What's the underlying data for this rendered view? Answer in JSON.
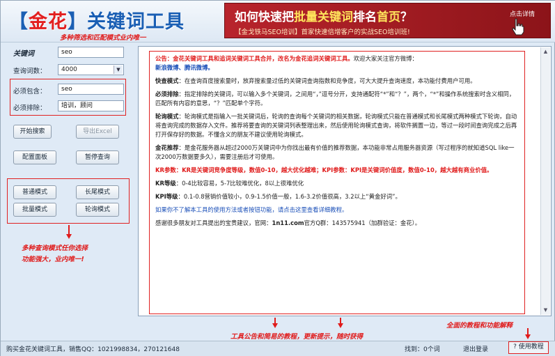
{
  "header": {
    "logo": {
      "bracket_open": "【",
      "jinhua": "金花",
      "bracket_close": "】",
      "title": "关键词工具"
    },
    "banner": {
      "title_pre": "如何快速把",
      "title_hl": "批量关键词",
      "title_mid": "排名",
      "title_hl2": "首页",
      "title_end": "？",
      "subtitle": "【金戈铁马SEO培训】首家快速倍增客户的实战SEO培训班!",
      "detail": "点击详情"
    }
  },
  "annotations": {
    "filter_modes": "多种筛选和匹配模式业内唯一",
    "keyword_label": "关键词",
    "query_modes": "多种查询模式任你选择\n功能强大，业内唯一!",
    "notice_tutorial": "工具公告和简易的教程，更新提示，随时获得",
    "full_tutorial": "全面的教程和功能解释"
  },
  "form": {
    "keyword_value": "seo",
    "query_count_label": "查询词数：",
    "query_count_value": "4000",
    "must_include_label": "必须包含：",
    "must_include_value": "seo",
    "must_exclude_label": "必须排除：",
    "must_exclude_value": "培训，顾问"
  },
  "buttons": {
    "start": "开始搜索",
    "export": "导出Excel",
    "config": "配置面板",
    "pause": "暂停查询",
    "normal": "普通模式",
    "longtail": "长尾模式",
    "batch": "批量模式",
    "poll": "轮询模式"
  },
  "doc": {
    "notice_label": "公告：",
    "notice_text": "金花关键词工具和追词关键词工具合并，改名为金花追词关键词工具。",
    "notice_tail": "欢迎大家关注官方微博：",
    "weibo": "新浪微博、腾讯微博。",
    "fast_label": "快查模式",
    "fast_text": "：在查询百度搜索量时，放弃搜索量过低的关键词查询指数和竞争度，可大大提升查询速度，本功能付费用户可用。",
    "exclude_label": "必须排除",
    "exclude_text": "：指定排除的关键词，可以输入多个关键词，之间用“，”逗号分开，支持通配符“*”和“？”，两个，“*”和操作系统搜索时含义相同，匹配所有内容的意思，“？”匹配单个字符。",
    "poll_label": "轮询模式",
    "poll_text": "：轮询模式是指输入一批关键词后，轮询的查询每个关键词的相关数据，轮询模式只能在普通模式和长尾模式两种模式下轮询，自动将查询完成的数据存入文件。推荐将要查询的关键词列表整理出来，然后使用轮询模式查询，将软件搁置一边，等过一段时间查询完成之后再打开保存好的数据。不懂含义的朋友不建议使用轮询模式。",
    "recommend_label": "金花推荐",
    "recommend_text": "：是金花服务器从超过2000万关键词中为你找出最有价值的推荐数据，本功能非常占用服务器资源（写过程序的就知道SQL like一次2000万数据要多久），需要注册后才可使用。",
    "kr_text": "KR参数：KR是关键词竞争度等级，数值0-10，越大优化越难；KPI参数：KPI是关键词价值度，数值0-10，越大越有商业价值。",
    "kr_level_label": "KR等级",
    "kr_level_text": "：0-4比较容易，5-7比较难优化，8以上很难优化",
    "kpi_level_label": "KPI等级",
    "kpi_level_text": "：0.1-0.8营销价值较小，0.9-1.5价值一般，1.6-3.2价值很高，3.2以上“黄金好词”。",
    "tip_text": "如果你不了解本工具的使用方法或者按钮功能，请点击这里查看详细教程。",
    "thanks_text": "感谢很多朋友对工具提出的宝贵建议，官网：",
    "site": "1n11.com",
    "qq_text": "官方Q群：143575941（加群验证：金花）。"
  },
  "footer": {
    "buy": "购买金花关键词工具，销售QQ：1021998834，270121648",
    "found": "找到：0个词",
    "logout": "退出登录",
    "help": "? 使用教程"
  }
}
